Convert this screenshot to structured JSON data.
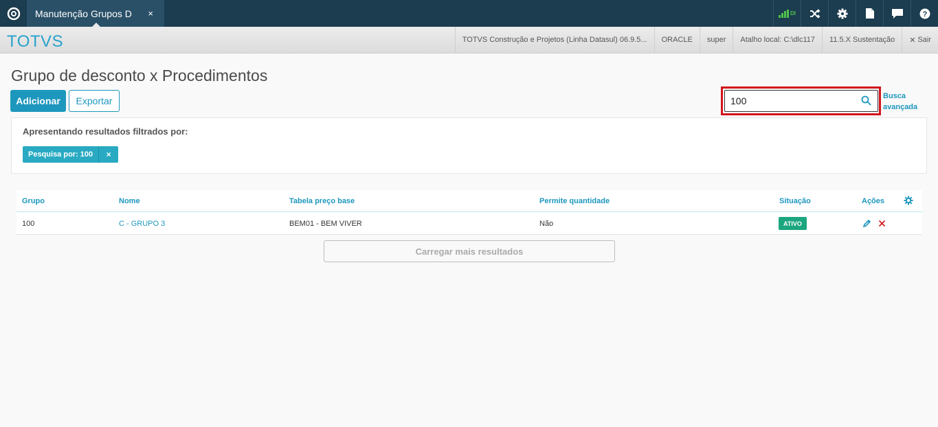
{
  "topbar": {
    "tab_title": "Manutenção Grupos D",
    "tab_close": "×",
    "signal_text": "DI",
    "icons": [
      "totvs-logo-icon",
      "signal-icon",
      "shuffle-icon",
      "gear-icon",
      "document-icon",
      "chat-icon",
      "help-icon"
    ]
  },
  "header": {
    "brand": "TOTVS",
    "product": "TOTVS Construção e Projetos (Linha Datasul) 06.9.5...",
    "database": "ORACLE",
    "user": "super",
    "shortcut": "Atalho local: C:\\dlc117",
    "version": "11.5.X Sustentação",
    "logout": "Sair"
  },
  "page": {
    "title": "Grupo de desconto x Procedimentos",
    "add_label": "Adicionar",
    "export_label": "Exportar",
    "search_value": "100",
    "advanced_search": "Busca avançada"
  },
  "filter": {
    "title": "Apresentando resultados filtrados por:",
    "chip": "Pesquisa por: 100",
    "chip_close": "×"
  },
  "table": {
    "columns": [
      "Grupo",
      "Nome",
      "Tabela preço base",
      "Permite quantidade",
      "Situação",
      "Ações"
    ],
    "rows": [
      {
        "grupo": "100",
        "nome": "C - GRUPO 3",
        "tabela": "BEM01 - BEM VIVER",
        "permite": "Não",
        "situacao": "ATIVO"
      }
    ]
  },
  "load_more": "Carregar mais resultados",
  "colors": {
    "topbar": "#1c3c4f",
    "accent": "#1d97bd",
    "status_active": "#1ca67f",
    "highlight": "#d2151c"
  }
}
